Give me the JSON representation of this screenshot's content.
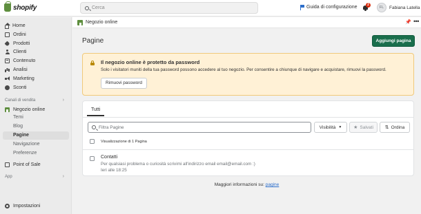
{
  "topbar": {
    "logo_text": "shopify",
    "search_placeholder": "Cerca",
    "setup_guide": "Guida di configurazione",
    "notifications_count": "2",
    "user_initials": "FL",
    "user_name": "Fabiana Latella"
  },
  "sidebar": {
    "items": [
      {
        "label": "Home",
        "icon": "home-icon"
      },
      {
        "label": "Ordini",
        "icon": "orders-icon"
      },
      {
        "label": "Prodotti",
        "icon": "tag-icon"
      },
      {
        "label": "Clienti",
        "icon": "person-icon"
      },
      {
        "label": "Contenuto",
        "icon": "content-icon"
      },
      {
        "label": "Analisi",
        "icon": "bar-chart-icon"
      },
      {
        "label": "Marketing",
        "icon": "megaphone-icon"
      },
      {
        "label": "Sconti",
        "icon": "discount-icon"
      }
    ],
    "channels_label": "Canali di vendita",
    "online_store": "Negozio online",
    "online_store_subitems": [
      "Temi",
      "Blog",
      "Pagine",
      "Navigazione",
      "Preferenze"
    ],
    "active_subitem": "Pagine",
    "point_of_sale": "Point of Sale",
    "app_label": "App",
    "settings": "Impostazioni"
  },
  "breadcrumb": {
    "label": "Negozio online"
  },
  "main": {
    "title": "Pagine",
    "add_page_button": "Aggiungi pagina"
  },
  "banner": {
    "title": "Il negozio online è protetto da password",
    "text": "Solo i visitatori muniti della tua password possono accedere al tuo negozio. Per consentire a chiunque di navigare e acquistare, rimuovi la password.",
    "button": "Rimuovi password"
  },
  "pages_card": {
    "tab": "Tutti",
    "filter_placeholder": "Filtra Pagine",
    "visibility_button": "Visibilità",
    "saved_button": "Salvati",
    "order_button": "Ordina",
    "list_header": "Visualizzazione di 1 Pagina",
    "rows": [
      {
        "title": "Contatti",
        "subtitle": "Per qualsiasi problema o curiosità scrivimi all'indirizzo email email@email.com :)",
        "date": "Ieri alle 18:25"
      }
    ]
  },
  "footer": {
    "text": "Maggiori informazioni su:",
    "link": "pagine"
  },
  "colors": {
    "primary": "#1a6e4c",
    "brand": "#5e8e3e",
    "warning_bg": "#fff1d6",
    "link": "#2c6ecb"
  }
}
